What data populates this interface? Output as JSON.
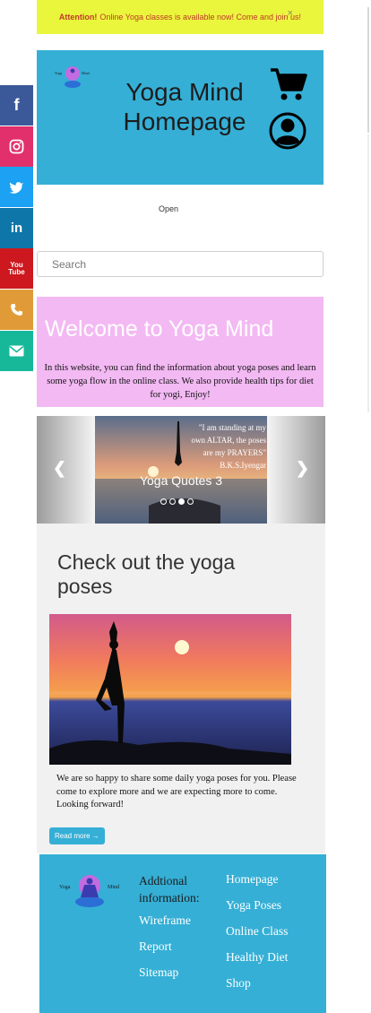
{
  "announcement": {
    "prefix": "Attention!",
    "text": "Online Yoga classes is available now! Come and join us!",
    "close": "×"
  },
  "header": {
    "logo_text": "Yoga Mind",
    "title": "Yoga Mind Homepage",
    "icons": [
      "cart-icon",
      "user-icon"
    ]
  },
  "nav": {
    "open_label": "Open"
  },
  "search": {
    "placeholder": "Search",
    "value": ""
  },
  "welcome": {
    "title": "Welcome to Yoga Mind",
    "body": "In this website, you can find the information about yoga poses and learn some yoga flow in the online class. We also provide health tips for diet for yogi, Enjoy!"
  },
  "carousel": {
    "caption": "Yoga Quotes 3",
    "quote": "\"I am standing at my own ALTAR, the poses are my PRAYERS\" B.K.S.Iyengar",
    "slide_count": 4,
    "active_index": 2,
    "prev_icon": "chevron-left-icon",
    "next_icon": "chevron-right-icon"
  },
  "poses": {
    "title": "Check out the yoga poses",
    "body": "We are so happy to share some daily yoga poses for you. Please come to explore more and we are expecting more to come. Looking forward!",
    "button_label": "Read more →"
  },
  "footer": {
    "logo_text": "Yoga Mind",
    "info_heading": "Addtional information:",
    "info_links": [
      "Wireframe",
      "Report",
      "Sitemap"
    ],
    "site_links": [
      "Homepage",
      "Yoga Poses",
      "Online Class",
      "Healthy Diet",
      "Shop"
    ]
  },
  "social": {
    "items": [
      {
        "name": "facebook",
        "glyph": "f",
        "color": "#3b5998"
      },
      {
        "name": "instagram",
        "glyph": "◎",
        "color": "#e1306c"
      },
      {
        "name": "twitter",
        "glyph": "🐦",
        "color": "#1da1f2"
      },
      {
        "name": "linkedin",
        "glyph": "in",
        "color": "#0e76a8"
      },
      {
        "name": "youtube",
        "glyph": "You",
        "color": "#cc181e"
      },
      {
        "name": "phone",
        "glyph": "✆",
        "color": "#e09b38"
      },
      {
        "name": "email",
        "glyph": "✉",
        "color": "#17b89a"
      }
    ]
  },
  "colors": {
    "accent": "#35afd6",
    "welcome_bg": "#f3b9f3",
    "announce_bg": "#eaf63c"
  }
}
